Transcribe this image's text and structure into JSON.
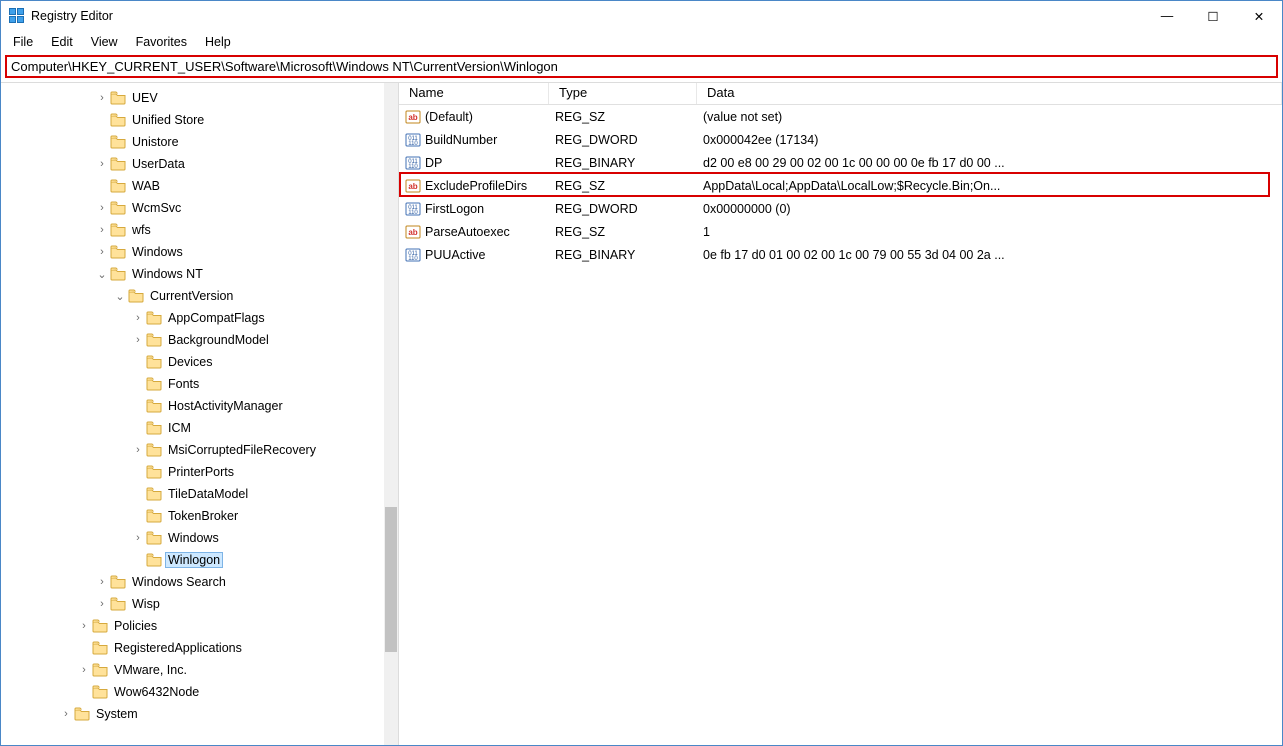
{
  "window": {
    "title": "Registry Editor"
  },
  "title_controls": {
    "min": "—",
    "max": "☐",
    "close": "✕"
  },
  "menu": [
    "File",
    "Edit",
    "View",
    "Favorites",
    "Help"
  ],
  "address": "Computer\\HKEY_CURRENT_USER\\Software\\Microsoft\\Windows NT\\CurrentVersion\\Winlogon",
  "tree": [
    {
      "depth": 5,
      "exp": ">",
      "label": "UEV"
    },
    {
      "depth": 5,
      "exp": "",
      "label": "Unified Store"
    },
    {
      "depth": 5,
      "exp": "",
      "label": "Unistore"
    },
    {
      "depth": 5,
      "exp": ">",
      "label": "UserData"
    },
    {
      "depth": 5,
      "exp": "",
      "label": "WAB"
    },
    {
      "depth": 5,
      "exp": ">",
      "label": "WcmSvc"
    },
    {
      "depth": 5,
      "exp": ">",
      "label": "wfs"
    },
    {
      "depth": 5,
      "exp": ">",
      "label": "Windows"
    },
    {
      "depth": 5,
      "exp": "v",
      "label": "Windows NT"
    },
    {
      "depth": 6,
      "exp": "v",
      "label": "CurrentVersion"
    },
    {
      "depth": 7,
      "exp": ">",
      "label": "AppCompatFlags"
    },
    {
      "depth": 7,
      "exp": ">",
      "label": "BackgroundModel"
    },
    {
      "depth": 7,
      "exp": "",
      "label": "Devices"
    },
    {
      "depth": 7,
      "exp": "",
      "label": "Fonts"
    },
    {
      "depth": 7,
      "exp": "",
      "label": "HostActivityManager"
    },
    {
      "depth": 7,
      "exp": "",
      "label": "ICM"
    },
    {
      "depth": 7,
      "exp": ">",
      "label": "MsiCorruptedFileRecovery"
    },
    {
      "depth": 7,
      "exp": "",
      "label": "PrinterPorts"
    },
    {
      "depth": 7,
      "exp": "",
      "label": "TileDataModel"
    },
    {
      "depth": 7,
      "exp": "",
      "label": "TokenBroker"
    },
    {
      "depth": 7,
      "exp": ">",
      "label": "Windows"
    },
    {
      "depth": 7,
      "exp": "",
      "label": "Winlogon",
      "selected": true
    },
    {
      "depth": 5,
      "exp": ">",
      "label": "Windows Search"
    },
    {
      "depth": 5,
      "exp": ">",
      "label": "Wisp"
    },
    {
      "depth": 4,
      "exp": ">",
      "label": "Policies"
    },
    {
      "depth": 4,
      "exp": "",
      "label": "RegisteredApplications"
    },
    {
      "depth": 4,
      "exp": ">",
      "label": "VMware, Inc."
    },
    {
      "depth": 4,
      "exp": "",
      "label": "Wow6432Node"
    },
    {
      "depth": 3,
      "exp": ">",
      "label": "System"
    }
  ],
  "list": {
    "columns": {
      "name": "Name",
      "type": "Type",
      "data": "Data"
    },
    "rows": [
      {
        "icon": "sz",
        "name": "(Default)",
        "type": "REG_SZ",
        "data": "(value not set)"
      },
      {
        "icon": "bin",
        "name": "BuildNumber",
        "type": "REG_DWORD",
        "data": "0x000042ee (17134)"
      },
      {
        "icon": "bin",
        "name": "DP",
        "type": "REG_BINARY",
        "data": "d2 00 e8 00 29 00 02 00 1c 00 00 00 0e fb 17 d0 00 ..."
      },
      {
        "icon": "sz",
        "name": "ExcludeProfileDirs",
        "type": "REG_SZ",
        "data": "AppData\\Local;AppData\\LocalLow;$Recycle.Bin;On...",
        "highlighted": true
      },
      {
        "icon": "bin",
        "name": "FirstLogon",
        "type": "REG_DWORD",
        "data": "0x00000000 (0)"
      },
      {
        "icon": "sz",
        "name": "ParseAutoexec",
        "type": "REG_SZ",
        "data": "1"
      },
      {
        "icon": "bin",
        "name": "PUUActive",
        "type": "REG_BINARY",
        "data": "0e fb 17 d0 01 00 02 00 1c 00 79 00 55 3d 04 00 2a ..."
      }
    ]
  },
  "scroll": {
    "thumb_top_pct": 64,
    "thumb_height_pct": 22
  }
}
